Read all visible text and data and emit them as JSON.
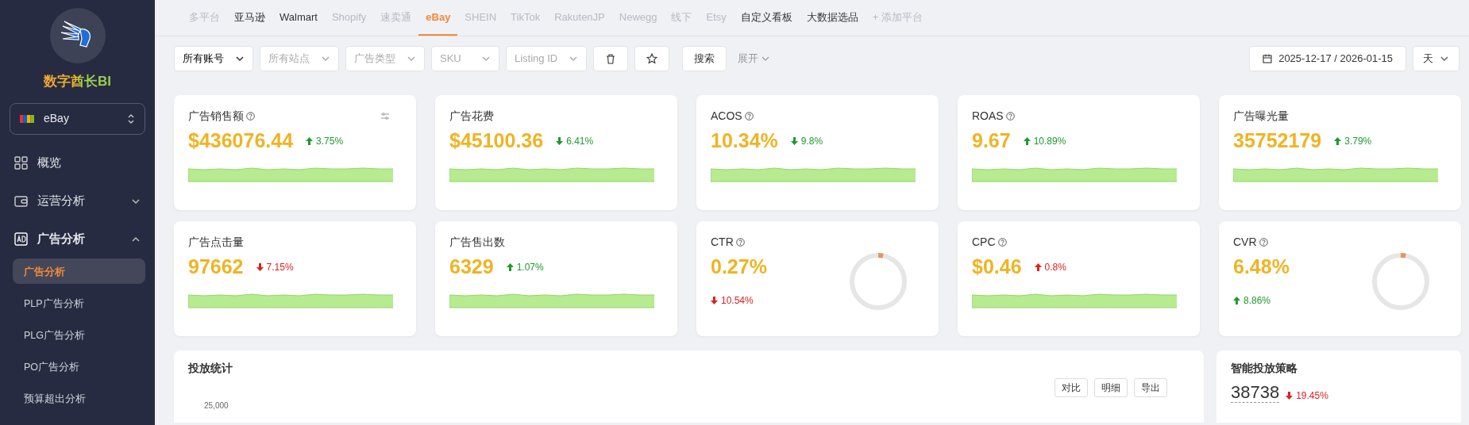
{
  "sidebar": {
    "brand": "数字酋长BI",
    "platform_select": {
      "value": "eBay"
    },
    "menu": [
      {
        "label": "概览",
        "kind": "grid"
      },
      {
        "label": "运营分析",
        "kind": "wallet",
        "expanded": false
      },
      {
        "label": "广告分析",
        "kind": "ad",
        "expanded": true,
        "children": [
          {
            "label": "广告分析",
            "selected": true
          },
          {
            "label": "PLP广告分析",
            "selected": false
          },
          {
            "label": "PLG广告分析",
            "selected": false
          },
          {
            "label": "PO广告分析",
            "selected": false
          },
          {
            "label": "预算超出分析",
            "selected": false
          }
        ]
      }
    ]
  },
  "tabs": [
    {
      "label": "多平台",
      "enabled": false,
      "selected": false
    },
    {
      "label": "亚马逊",
      "enabled": true,
      "selected": false
    },
    {
      "label": "Walmart",
      "enabled": true,
      "selected": false
    },
    {
      "label": "Shopify",
      "enabled": false,
      "selected": false
    },
    {
      "label": "速卖通",
      "enabled": false,
      "selected": false
    },
    {
      "label": "eBay",
      "enabled": true,
      "selected": true
    },
    {
      "label": "SHEIN",
      "enabled": false,
      "selected": false
    },
    {
      "label": "TikTok",
      "enabled": false,
      "selected": false
    },
    {
      "label": "RakutenJP",
      "enabled": false,
      "selected": false
    },
    {
      "label": "Newegg",
      "enabled": false,
      "selected": false
    },
    {
      "label": "线下",
      "enabled": false,
      "selected": false
    },
    {
      "label": "Etsy",
      "enabled": false,
      "selected": false
    },
    {
      "label": "自定义看板",
      "enabled": true,
      "selected": false
    },
    {
      "label": "大数据选品",
      "enabled": true,
      "selected": false
    },
    {
      "label": "+ 添加平台",
      "enabled": false,
      "selected": false
    }
  ],
  "filters": [
    {
      "kind": "value",
      "text": "所有账号"
    },
    {
      "kind": "placeholder",
      "text": "所有站点"
    },
    {
      "kind": "placeholder",
      "text": "广告类型"
    },
    {
      "kind": "placeholder",
      "text": "SKU"
    },
    {
      "kind": "placeholder",
      "text": "Listing ID"
    }
  ],
  "search_button": "搜索",
  "expand_link": "展开",
  "date_range": "2025-12-17 / 2026-01-15",
  "granularity": "天",
  "cards": [
    {
      "title": "广告销售额",
      "help": true,
      "settings": true,
      "value": "$436076.44",
      "change": "3.75%",
      "increase": true,
      "positive": true,
      "kind": "sparkline"
    },
    {
      "title": "广告花费",
      "help": false,
      "settings": false,
      "value": "$45100.36",
      "change": "6.41%",
      "increase": false,
      "positive": true,
      "kind": "sparkline"
    },
    {
      "title": "ACOS",
      "help": true,
      "settings": false,
      "value": "10.34%",
      "change": "9.8%",
      "increase": false,
      "positive": true,
      "kind": "sparkline"
    },
    {
      "title": "ROAS",
      "help": true,
      "settings": false,
      "value": "9.67",
      "change": "10.89%",
      "increase": true,
      "positive": true,
      "kind": "sparkline"
    },
    {
      "title": "广告曝光量",
      "help": false,
      "settings": false,
      "value": "35752179",
      "change": "3.79%",
      "increase": true,
      "positive": true,
      "kind": "sparkline"
    },
    {
      "title": "广告点击量",
      "help": false,
      "settings": false,
      "value": "97662",
      "change": "7.15%",
      "increase": false,
      "positive": false,
      "kind": "sparkline"
    },
    {
      "title": "广告售出数",
      "help": false,
      "settings": false,
      "value": "6329",
      "change": "1.07%",
      "increase": true,
      "positive": true,
      "kind": "sparkline"
    },
    {
      "title": "CTR",
      "help": true,
      "settings": false,
      "value": "0.27%",
      "change": "10.54%",
      "increase": false,
      "positive": false,
      "kind": "ring",
      "level": 0.03
    },
    {
      "title": "CPC",
      "help": true,
      "settings": false,
      "value": "$0.46",
      "change": "0.8%",
      "increase": true,
      "positive": false,
      "kind": "sparkline"
    },
    {
      "title": "CVR",
      "help": true,
      "settings": false,
      "value": "6.48%",
      "change": "8.86%",
      "increase": true,
      "positive": true,
      "kind": "ring",
      "level": 0.03
    }
  ],
  "stats_panel": {
    "title": "投放统计",
    "buttons": [
      "对比",
      "明细",
      "导出"
    ],
    "axis_tick": "25,000"
  },
  "strategy_panel": {
    "title": "智能投放策略",
    "value": "38738",
    "change": "19.45%",
    "increase": false,
    "positive": false
  }
}
